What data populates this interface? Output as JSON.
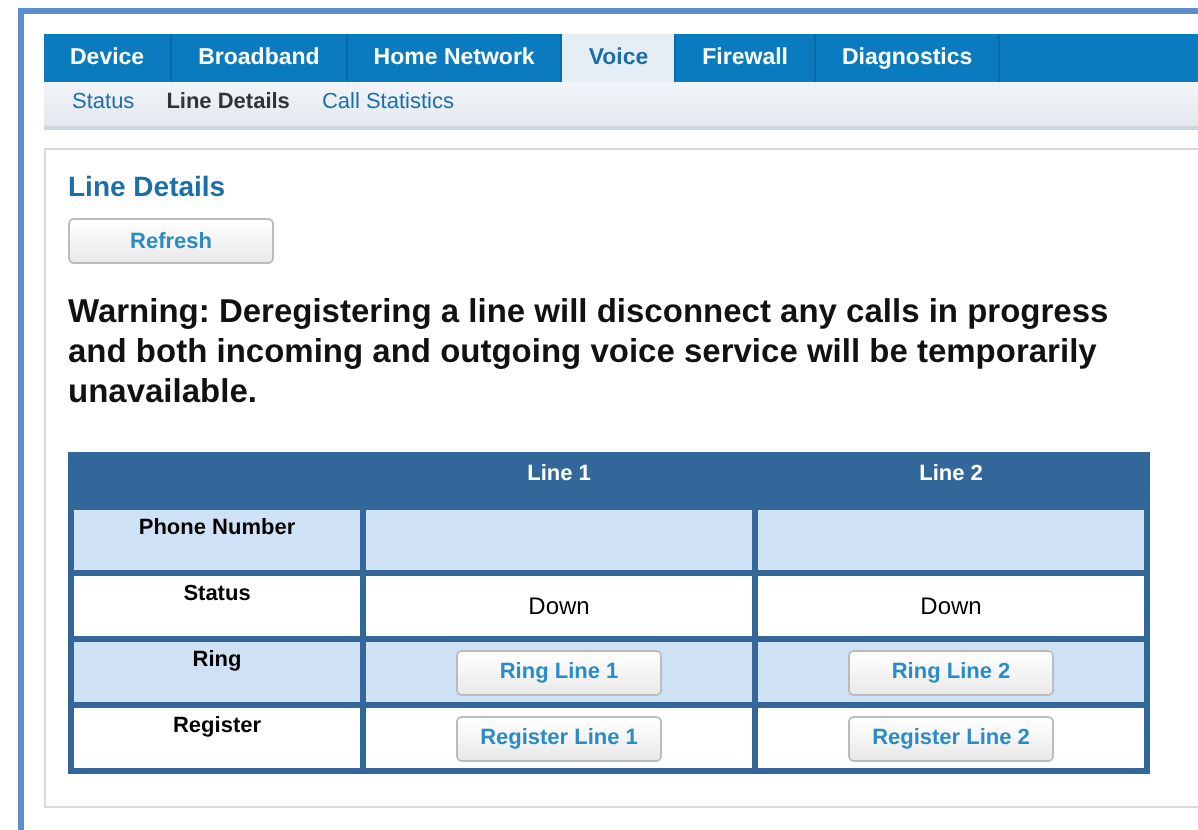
{
  "tabs": [
    {
      "label": "Device",
      "selected": false
    },
    {
      "label": "Broadband",
      "selected": false
    },
    {
      "label": "Home Network",
      "selected": false
    },
    {
      "label": "Voice",
      "selected": true
    },
    {
      "label": "Firewall",
      "selected": false
    },
    {
      "label": "Diagnostics",
      "selected": false
    }
  ],
  "subtabs": [
    {
      "label": "Status",
      "selected": false
    },
    {
      "label": "Line Details",
      "selected": true
    },
    {
      "label": "Call Statistics",
      "selected": false
    }
  ],
  "panel": {
    "title": "Line Details",
    "refresh_button": "Refresh",
    "warning": "Warning: Deregistering a line will disconnect any calls in progress and both incoming and outgoing voice service will be temporarily unavailable.",
    "table": {
      "columns": [
        "Line 1",
        "Line 2"
      ],
      "rows": [
        {
          "label": "Phone Number",
          "kind": "empty"
        },
        {
          "label": "Status",
          "kind": "text",
          "cells": [
            "Down",
            "Down"
          ]
        },
        {
          "label": "Ring",
          "kind": "button",
          "cells": [
            "Ring Line 1",
            "Ring Line 2"
          ]
        },
        {
          "label": "Register",
          "kind": "button",
          "cells": [
            "Register Line 1",
            "Register Line 2"
          ]
        }
      ]
    }
  }
}
